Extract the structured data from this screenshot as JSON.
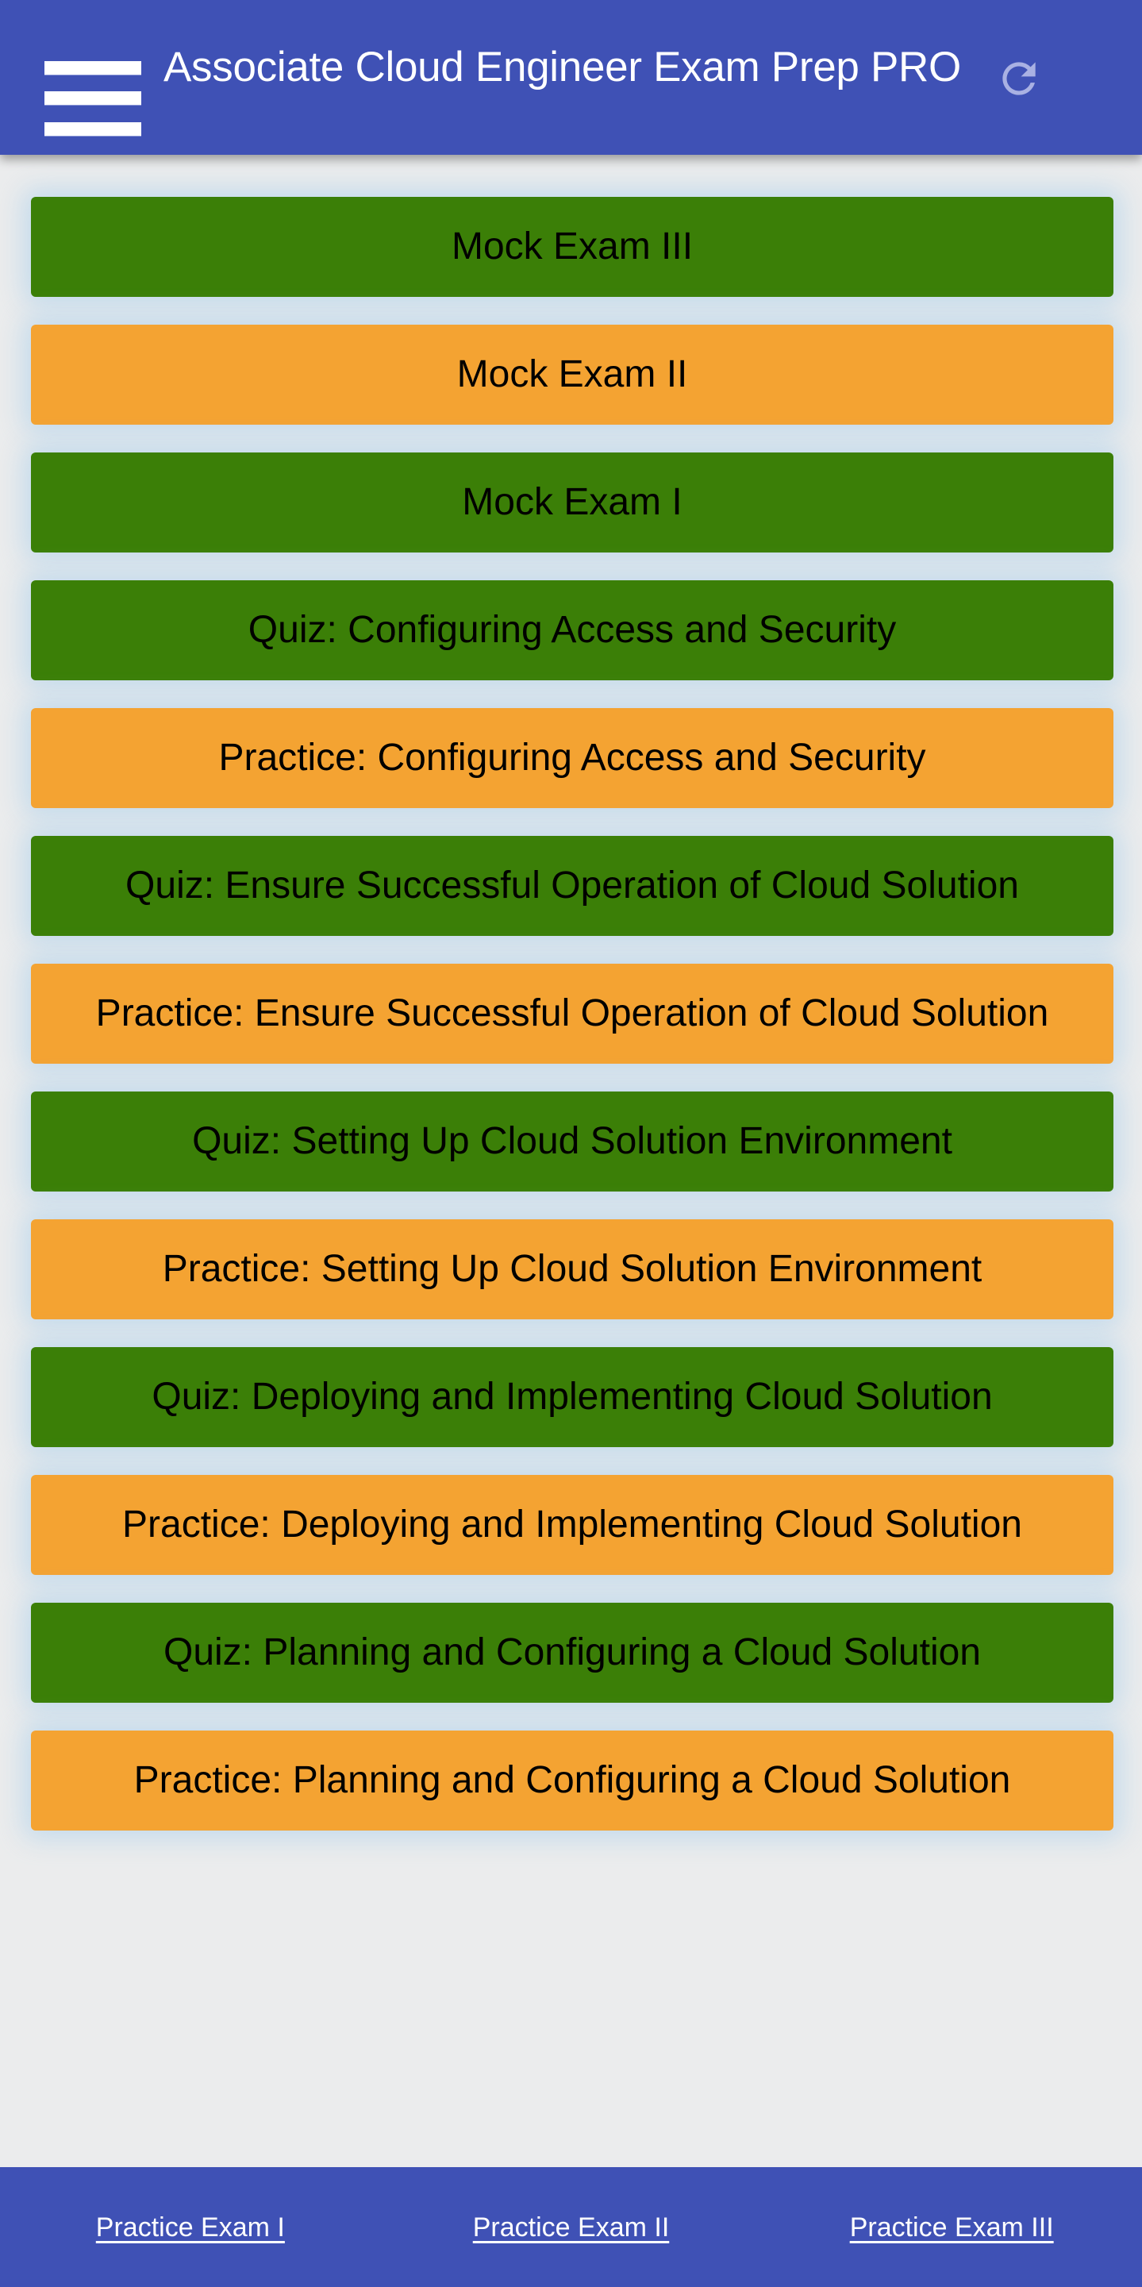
{
  "header": {
    "menu_icon": "hamburger-menu-icon",
    "title": "Associate Cloud Engineer Exam Prep PRO",
    "refresh_icon": "refresh-icon",
    "background_color": "#3f51b5"
  },
  "menu": {
    "items": [
      {
        "label": "Mock Exam III",
        "color": "green"
      },
      {
        "label": "Mock Exam II",
        "color": "orange"
      },
      {
        "label": "Mock Exam I",
        "color": "green"
      },
      {
        "label": "Quiz: Configuring Access and Security",
        "color": "green"
      },
      {
        "label": "Practice: Configuring Access and Security",
        "color": "orange"
      },
      {
        "label": "Quiz: Ensure Successful Operation of Cloud Solution",
        "color": "green"
      },
      {
        "label": "Practice: Ensure Successful Operation of Cloud Solution",
        "color": "orange"
      },
      {
        "label": "Quiz: Setting Up Cloud Solution Environment",
        "color": "green"
      },
      {
        "label": "Practice: Setting Up Cloud Solution Environment",
        "color": "orange"
      },
      {
        "label": "Quiz: Deploying and Implementing Cloud Solution",
        "color": "green"
      },
      {
        "label": "Practice: Deploying and Implementing Cloud Solution",
        "color": "orange"
      },
      {
        "label": "Quiz: Planning and Configuring a Cloud Solution",
        "color": "green"
      },
      {
        "label": "Practice: Planning and Configuring a Cloud Solution",
        "color": "orange"
      }
    ],
    "colors": {
      "green": "#3b7f07",
      "orange": "#f4a332"
    }
  },
  "footer": {
    "links": [
      {
        "label": "Practice Exam I"
      },
      {
        "label": "Practice Exam II"
      },
      {
        "label": "Practice Exam III"
      }
    ]
  }
}
